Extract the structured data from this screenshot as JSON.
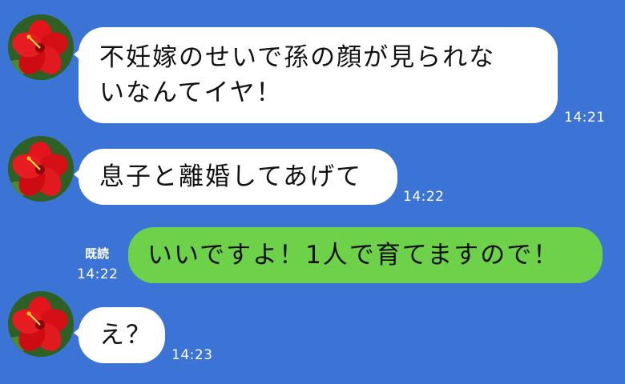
{
  "theme": {
    "background": "#3b74d4",
    "incoming_bubble": "#ffffff",
    "outgoing_bubble": "#6ed14a",
    "text": "#111111",
    "meta_text": "#ffffff"
  },
  "messages": [
    {
      "direction": "incoming",
      "avatar_icon": "hibiscus-flower-avatar",
      "lines": [
        "不妊嫁のせいで孫の顔が見られな",
        "いなんてイヤ！"
      ],
      "time": "14:21"
    },
    {
      "direction": "incoming",
      "avatar_icon": "hibiscus-flower-avatar",
      "lines": [
        "息子と離婚してあげて"
      ],
      "time": "14:22"
    },
    {
      "direction": "outgoing",
      "lines": [
        "いいですよ！1人で育てますので！"
      ],
      "read_label": "既読",
      "time": "14:22"
    },
    {
      "direction": "incoming",
      "avatar_icon": "hibiscus-flower-avatar",
      "lines": [
        "え？"
      ],
      "time": "14:23"
    }
  ]
}
